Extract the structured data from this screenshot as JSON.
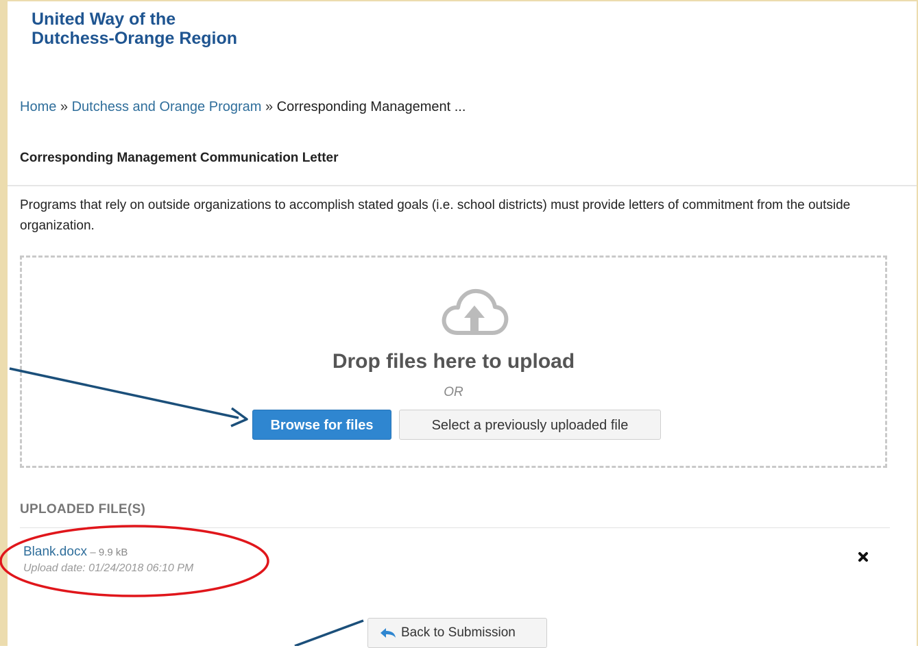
{
  "header": {
    "org_line1": "United Way of the",
    "org_line2": "Dutchess-Orange Region"
  },
  "breadcrumb": {
    "home": "Home",
    "separator": "»",
    "program": "Dutchess and Orange Program",
    "current": "Corresponding Management ..."
  },
  "page": {
    "title": "Corresponding Management Communication Letter",
    "description": "Programs that rely on outside organizations to accomplish stated goals (i.e. school districts) must provide letters of commitment from the outside organization."
  },
  "upload": {
    "drop_text": "Drop files here to upload",
    "or_text": "OR",
    "browse_label": "Browse for files",
    "select_previous_label": "Select a previously uploaded file",
    "icon": "cloud-upload-icon"
  },
  "uploaded_files": {
    "heading": "UPLOADED FILE(S)",
    "items": [
      {
        "name": "Blank.docx",
        "size": "– 9.9 kB",
        "upload_date": "Upload date: 01/24/2018 06:10 PM"
      }
    ]
  },
  "actions": {
    "back_label": "Back to Submission"
  },
  "colors": {
    "frame": "#ecdcae",
    "brand": "#1f5591",
    "link": "#2f6e9b",
    "primary_button": "#2f86d0",
    "annotation_arrow": "#1b4f7a",
    "annotation_circle": "#e0161b"
  }
}
